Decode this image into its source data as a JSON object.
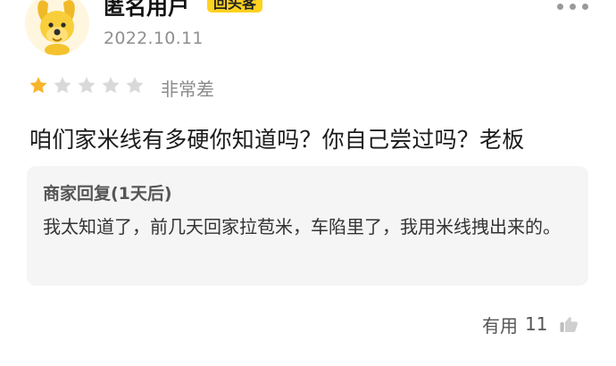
{
  "review": {
    "username": "匿名用户",
    "badge": "回头客",
    "date": "2022.10.11",
    "rating": {
      "value": 1,
      "max": 5,
      "label": "非常差"
    },
    "text": "咱们家米线有多硬你知道吗？你自己尝过吗？老板"
  },
  "merchant_reply": {
    "title": "商家回复(1天后)",
    "text": "我太知道了，前几天回家拉苞米，车陷里了，我用米线拽出来的。"
  },
  "footer": {
    "useful_label": "有用",
    "useful_count": "11"
  },
  "icons": {
    "avatar": "yellow-dog-avatar",
    "more": "more-dots-icon",
    "star": "star-icon",
    "thumb": "thumbs-up-icon"
  },
  "colors": {
    "badge": "#ffd21f",
    "star_active": "#f7b52c",
    "star_inactive": "#d9d9d9",
    "reply_bg": "#f5f5f5",
    "muted_text": "#8f8f8f"
  }
}
